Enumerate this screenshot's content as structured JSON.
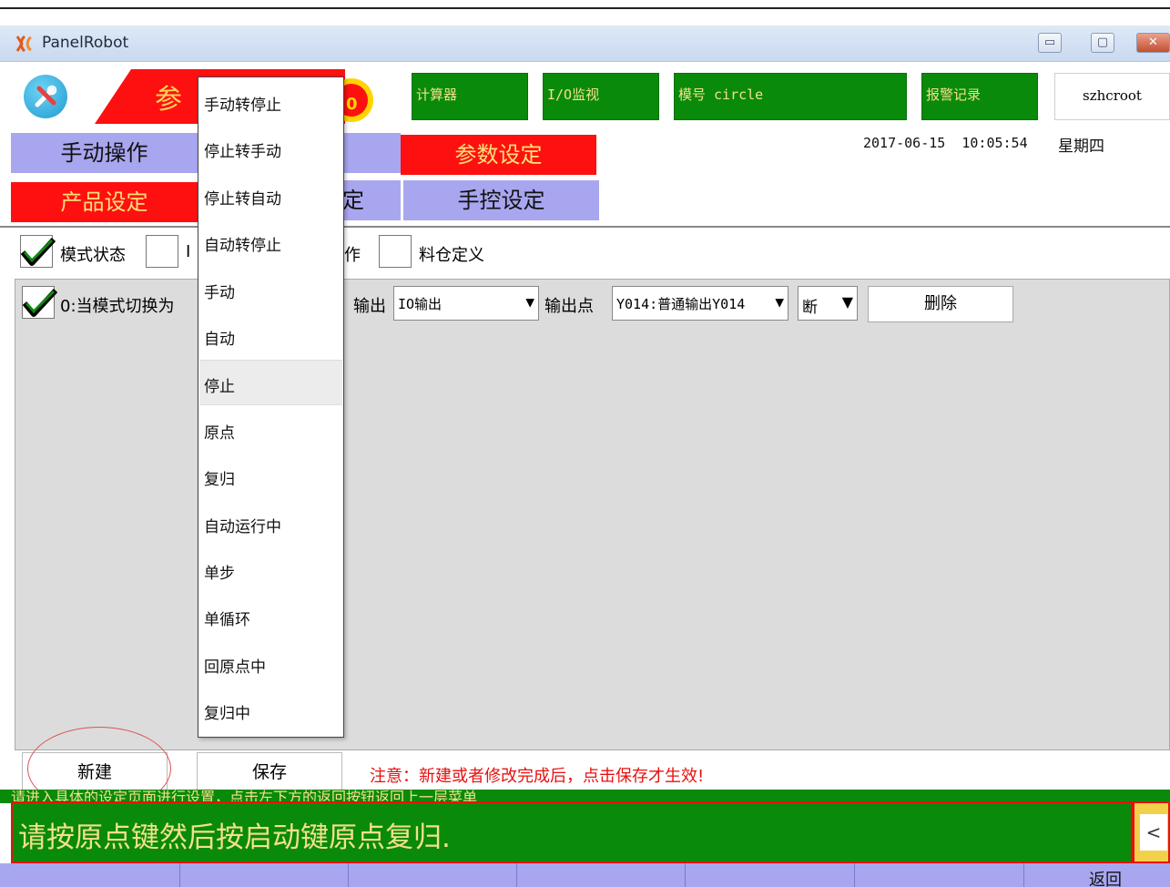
{
  "window": {
    "title": "PanelRobot",
    "minimize_label": "▭",
    "maximize_label": "▢",
    "close_label": "✕"
  },
  "header": {
    "param_banner_text": "参",
    "param_badge": "0",
    "buttons": {
      "calculator": "计算器",
      "io_monitor": "I/O监视",
      "mold": "模号 circle",
      "alarm_log": "报警记录"
    },
    "user": "szhcroot",
    "date": "2017-06-15",
    "time": "10:05:54",
    "weekday": "星期四"
  },
  "tabs": {
    "manual_operation": "手动操作",
    "param_settings": "参数设定",
    "product_settings": "产品设定",
    "partial_hidden": "定",
    "manual_control_settings": "手控设定"
  },
  "checkbox_row": {
    "mode_state": {
      "label": "模式状态",
      "checked": true
    },
    "io_item": {
      "label": "I",
      "checked": false
    },
    "action_item": {
      "label": "作",
      "checked": false
    },
    "silo_def": {
      "label": "料仓定义",
      "checked": false
    }
  },
  "rule_row": {
    "checked": true,
    "condition": "0:当模式切换为",
    "output_label": "输出",
    "output_type": "IO输出",
    "output_point_label": "输出点",
    "output_point": "Y014:普通输出Y014",
    "state": "断",
    "delete_label": "删除",
    "dropdown_arrow": "▼"
  },
  "dropdown": {
    "items": [
      "手动转停止",
      "停止转手动",
      "停止转自动",
      "自动转停止",
      "手动",
      "自动",
      "停止",
      "原点",
      "复归",
      "自动运行中",
      "单步",
      "单循环",
      "回原点中",
      "复归中"
    ],
    "hovered_index": 6
  },
  "bottom": {
    "new_label": "新建",
    "save_label": "保存",
    "notice": "注意：新建或者修改完成后，点击保存才生效!"
  },
  "status": {
    "hint": "请进入具体的设定页面进行设置，点击左下方的返回按钮返回上一层菜单",
    "message": "请按原点键然后按启动键原点复归.",
    "scroll_label": "<"
  },
  "nav": {
    "back_label": "返回"
  },
  "colors": {
    "green": "#0a8a0a",
    "red": "#ff1010",
    "tab_blue": "#a9a6f0",
    "status_text": "#f3e08a"
  }
}
